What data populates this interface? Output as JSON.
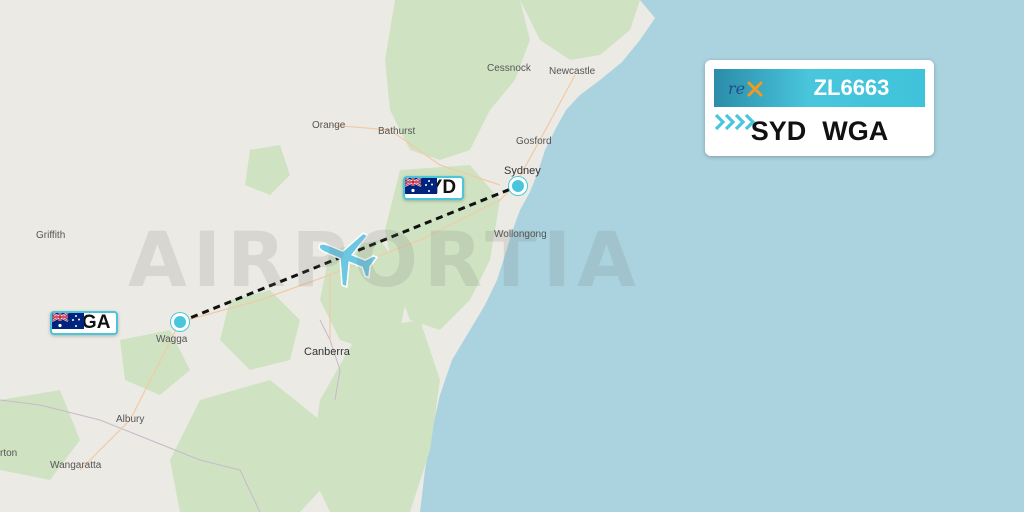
{
  "map": {
    "watermark": "AIRPORTIA",
    "towns": [
      {
        "name": "Cessnock"
      },
      {
        "name": "Newcastle"
      },
      {
        "name": "Orange"
      },
      {
        "name": "Bathurst"
      },
      {
        "name": "Gosford"
      },
      {
        "name": "Sydney"
      },
      {
        "name": "Griffith"
      },
      {
        "name": "Wollongong"
      },
      {
        "name": "Wagga"
      },
      {
        "name": "Canberra"
      },
      {
        "name": "Albury"
      },
      {
        "name": "rton"
      },
      {
        "name": "Wangaratta"
      }
    ],
    "colors": {
      "land": "#eceae4",
      "forest": "#cfe3c2",
      "water": "#aad3df",
      "route": "#111111",
      "accent": "#49c6dc"
    }
  },
  "airports": {
    "origin": {
      "code": "SYD",
      "flag": "australia-flag"
    },
    "destination": {
      "code": "WGA",
      "flag": "australia-flag"
    }
  },
  "flight": {
    "number": "ZL6663",
    "airline_logo": "rex-logo",
    "from": "SYD",
    "to": "WGA",
    "arrow_icon": "chevron-right-icon"
  }
}
